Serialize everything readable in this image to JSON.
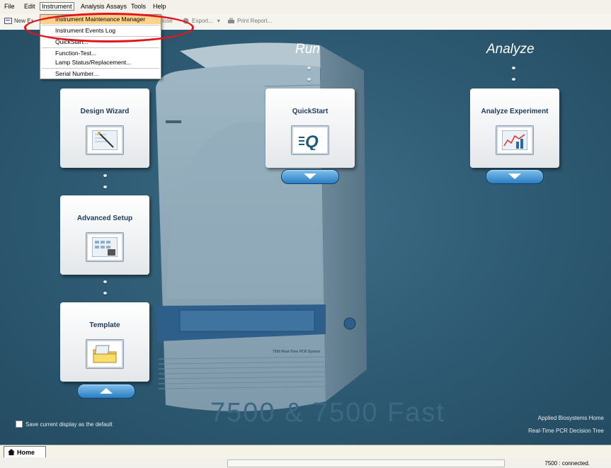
{
  "menu": [
    "File",
    "Edit",
    "Instrument",
    "Analysis",
    "Assays",
    "Tools",
    "Help"
  ],
  "toolbar": {
    "new_label": "New Ex",
    "close_label": "lose",
    "export_label": "Export...",
    "print_label": "Print Report..."
  },
  "instrument_menu": [
    {
      "label": "Instrument Maintenance Manager",
      "highlighted": true
    },
    {
      "label": "Instrument Events Log"
    },
    {
      "label": "QuickStart..."
    },
    {
      "label": "Function-Test..."
    },
    {
      "label": "Lamp Status/Replacement..."
    },
    {
      "label": "Serial Number..."
    }
  ],
  "headings": {
    "run": "Run",
    "analyze": "Analyze"
  },
  "cards": {
    "design_wizard": "Design Wizard",
    "advanced_setup": "Advanced Setup",
    "template": "Template",
    "quickstart": "QuickStart",
    "analyze_experiment": "Analyze Experiment"
  },
  "instrument_label": "7500 Real-Time PCR System",
  "watermark": "7500 & 7500 Fast",
  "save_default": "Save current display as the default",
  "links": {
    "home": "Applied Biosystems Home",
    "decision_tree": "Real-Time PCR Decision Tree"
  },
  "tab": {
    "home": "Home"
  },
  "status": {
    "connection": "7500 : connected."
  },
  "colors": {
    "background": "#2d5a72",
    "highlight": "#ffd28b",
    "annotation": "#e3141a",
    "heading_text": "#1e3b5f"
  }
}
